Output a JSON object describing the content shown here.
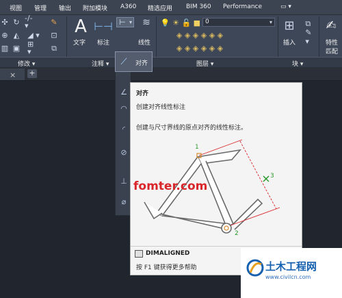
{
  "menu": {
    "items": [
      "视图",
      "管理",
      "输出",
      "附加模块",
      "A360",
      "精选应用",
      "BIM 360",
      "Performance"
    ]
  },
  "ribbon": {
    "text_label": "文字",
    "dim_label": "标注",
    "linear_label": "线性",
    "aligned_label": "对齐",
    "layer_value": "0",
    "insert_label": "插入",
    "properties_label": "特性",
    "match_label": "匹配",
    "panels": {
      "modify": "修改 ▾",
      "annotation": "注释 ▾",
      "layers": "图层 ▾",
      "block": "块 ▾"
    }
  },
  "tabs": {
    "close": "×",
    "new": "+"
  },
  "tooltip": {
    "title": "对齐",
    "subtitle": "创建对齐线性标注",
    "description": "创建与尺寸界线的原点对齐的线性标注。",
    "command": "DIMALIGNED",
    "help": "按 F1 键获得更多帮助",
    "points": [
      "1",
      "2",
      "3"
    ]
  },
  "watermark": "fomter.com",
  "logo": {
    "name": "土木工程网",
    "url": "www.civilcn.com"
  },
  "colors": {
    "ribbon": "#3e4757",
    "canvas": "#21252e",
    "tooltip_bg": "#f4f4f4",
    "dim_line": "#d9262a",
    "point_marker": "#2a9a2a",
    "watermark": "#d9262a"
  }
}
